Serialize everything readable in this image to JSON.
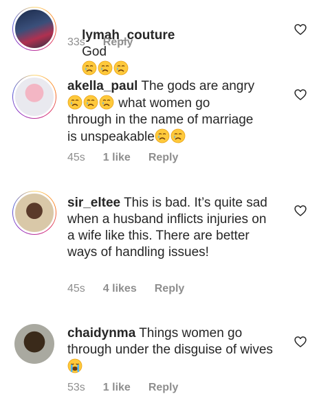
{
  "comments": [
    {
      "username": "lymah_couture",
      "body": "God",
      "emojis_after": 3,
      "time": "33s",
      "likes": "",
      "reply": "Reply"
    },
    {
      "username": "akella_paul",
      "body_line1": "The gods are angry",
      "body_line2_emojis": 3,
      "body_line2": "what women go",
      "body_line3": "through in the name of marriage",
      "body_line4": "is unspeakable",
      "time": "45s",
      "likes": "1 like",
      "reply": "Reply"
    },
    {
      "username": "sir_eltee",
      "body": "This is bad. It’s quite sad when a husband inflicts injuries on a wife like this. There are better ways of handling issues!",
      "time": "45s",
      "likes": "4 likes",
      "reply": "Reply"
    },
    {
      "username": "chaidynma",
      "body": "Things women go through under the disguise of wives",
      "time": "53s",
      "likes": "1 like",
      "reply": "Reply"
    }
  ],
  "icons": {
    "like": "heart-outline-icon",
    "cry": "crying-face-emoji",
    "sob": "sobbing-face-emoji"
  }
}
